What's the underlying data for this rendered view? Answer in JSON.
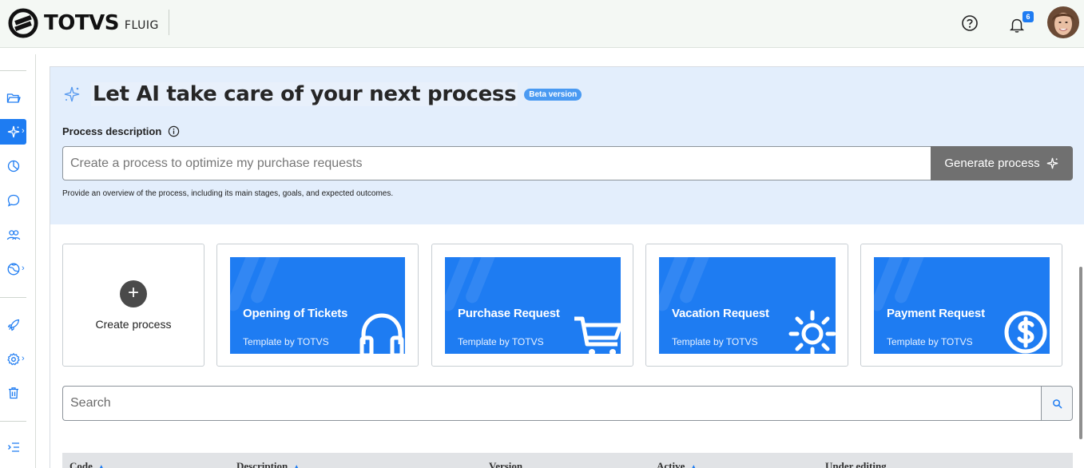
{
  "header": {
    "brand": "TOTVS",
    "product": "FLUIG",
    "notifications_count": "6"
  },
  "sidebar": {
    "items": [
      {
        "icon": "folder-icon"
      },
      {
        "icon": "ai-sparkle-icon",
        "active": true
      },
      {
        "icon": "pie-chart-icon"
      },
      {
        "icon": "chat-bubble-icon"
      },
      {
        "icon": "users-icon"
      },
      {
        "icon": "globe-icon"
      },
      {
        "icon": "rocket-icon"
      },
      {
        "icon": "gear-icon"
      },
      {
        "icon": "trash-icon"
      },
      {
        "icon": "expand-menu-icon"
      }
    ]
  },
  "ai_panel": {
    "title": "Let AI take care of your next process",
    "badge": "Beta version",
    "description_label": "Process description",
    "input_placeholder": "Create a process to optimize my purchase requests",
    "input_value": "",
    "generate_button": "Generate process",
    "helper_text": "Provide an overview of the process, including its main stages, goals, and expected outcomes."
  },
  "cards": {
    "create_label": "Create process",
    "templates": [
      {
        "title": "Opening of Tickets",
        "subtitle": "Template by TOTVS",
        "icon": "headset-icon"
      },
      {
        "title": "Purchase Request",
        "subtitle": "Template by TOTVS",
        "icon": "cart-icon"
      },
      {
        "title": "Vacation Request",
        "subtitle": "Template by TOTVS",
        "icon": "sun-icon"
      },
      {
        "title": "Payment Request",
        "subtitle": "Template by TOTVS",
        "icon": "dollar-coin-icon"
      }
    ]
  },
  "search": {
    "placeholder": "Search",
    "value": ""
  },
  "table": {
    "columns": [
      {
        "label": "Code",
        "sortable": true
      },
      {
        "label": "Description",
        "sortable": true
      },
      {
        "label": "Version",
        "sortable": false
      },
      {
        "label": "Active",
        "sortable": true
      },
      {
        "label": "Under editing",
        "sortable": false
      }
    ]
  },
  "colors": {
    "accent": "#1e7cf2",
    "ai_panel_bg": "#e3eefc",
    "generate_button_bg": "#707070",
    "table_header_bg": "#e1e3e6"
  }
}
